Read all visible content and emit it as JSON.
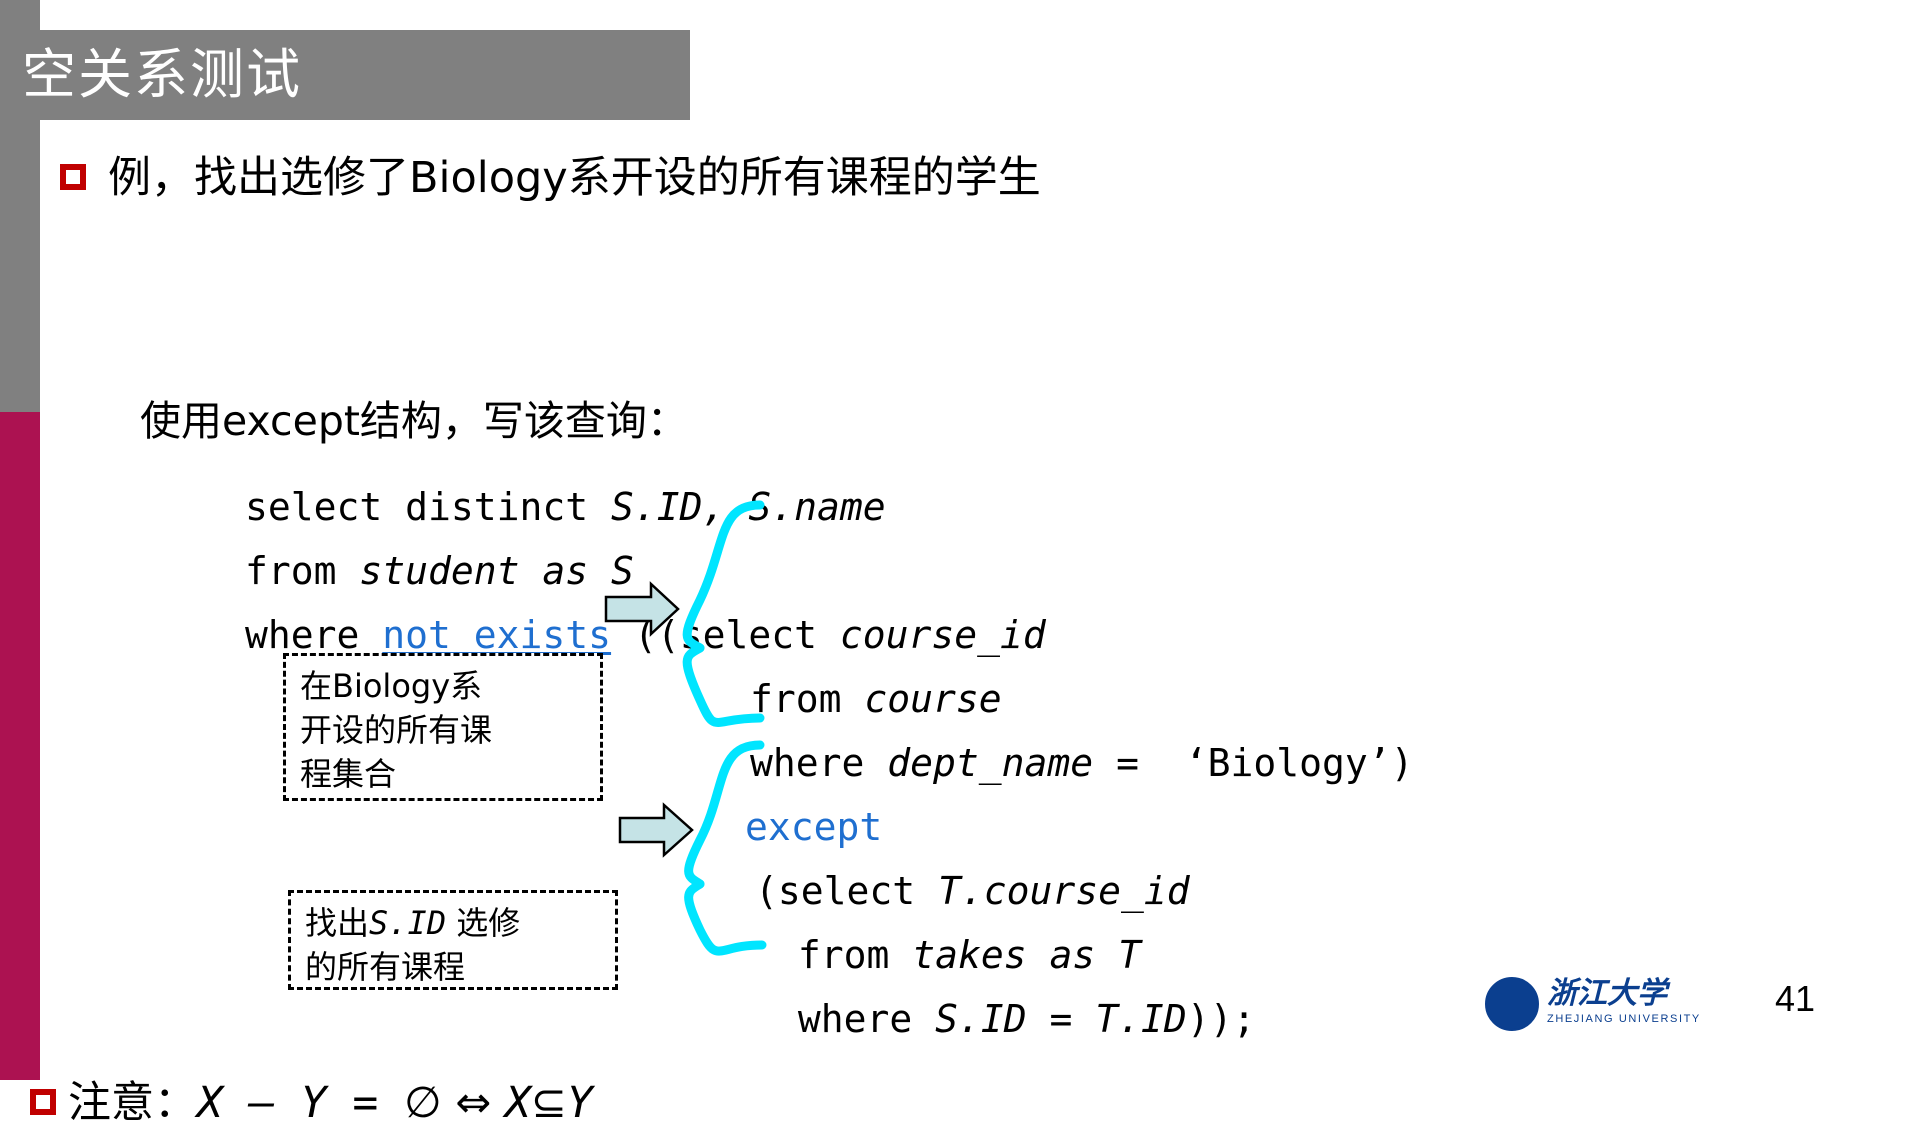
{
  "slide": {
    "title": "空关系测试",
    "page_number": "41",
    "colors": {
      "title_band": "#808080",
      "rail_gray": "#808080",
      "rail_crimson": "#ac1251",
      "bullet_red": "#c00000",
      "keyword_blue": "#1f6fd0",
      "brace_cyan": "#00e5ff",
      "arrow_fill": "#c5e3e6",
      "logo_blue": "#0b3f8f"
    }
  },
  "bullets": {
    "first": "例，找出选修了Biology系开设的所有课程的学生",
    "second_line": "使用except结构，写该查询："
  },
  "code": {
    "l1": {
      "kw": "select distinct ",
      "id": "S.ID, S.name"
    },
    "l2": {
      "kw": "from ",
      "id": "student as S"
    },
    "l3": {
      "kw": "where ",
      "blue": "not exists",
      "tail": " ((select ",
      "id": "course_id"
    },
    "l4": {
      "kw": "from ",
      "id": "course"
    },
    "l5": {
      "kw": "where ",
      "id": "dept_name",
      "tail": " =  ‘Biology’)"
    },
    "l6": {
      "blue": "except"
    },
    "l7": {
      "kw": "(select ",
      "id": "T.course_id"
    },
    "l8": {
      "kw": " from ",
      "id": "takes as T"
    },
    "l9": {
      "kw": " where ",
      "id": "S.ID = T.ID",
      "tail": "));"
    }
  },
  "annotations": {
    "box1": {
      "line1": "在Biology系",
      "line2": "开设的所有课",
      "line3": "程集合"
    },
    "box2": {
      "line1_pre": "找出",
      "line1_it": "S.ID",
      "line1_post": " 选修",
      "line2": "的所有课程"
    }
  },
  "note": {
    "label": "注意：",
    "expr_x": "X",
    "expr_minus": " – ",
    "expr_y": "Y",
    "expr_eq": " = ",
    "expr_empty": "∅",
    "expr_iff": "  ⇔  ",
    "expr_x2": "X",
    "expr_subset": "⊆",
    "expr_y2": "Y"
  },
  "logo": {
    "cn": "浙江大学",
    "en": "ZHEJIANG UNIVERSITY"
  }
}
